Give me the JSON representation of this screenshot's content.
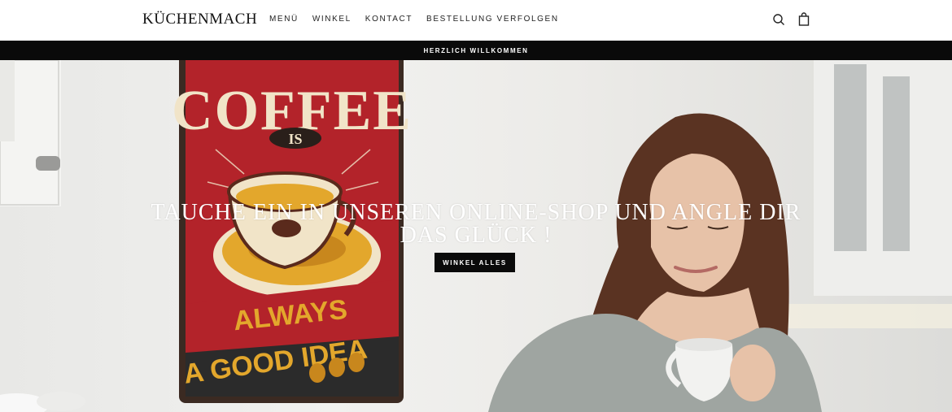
{
  "header": {
    "logo": "KÜCHENMACH",
    "nav": [
      {
        "label": "MENÜ"
      },
      {
        "label": "WINKEL"
      },
      {
        "label": "KONTACT"
      },
      {
        "label": "BESTELLUNG VERFOLGEN"
      }
    ],
    "icons": {
      "search": "search-icon",
      "cart": "shopping-bag-icon"
    }
  },
  "announcement": {
    "text": "HERZLICH WILLKOMMEN"
  },
  "hero": {
    "title": "TAUCHE EIN IN UNSEREN ONLINE-SHOP UND ANGLE DIR DAS GLÜCK !",
    "button": "WINKEL ALLES",
    "sign": {
      "line1": "COFFEE",
      "line2": "IS",
      "line3": "ALWAYS",
      "line4": "A GOOD IDEA"
    }
  },
  "colors": {
    "bar": "#0a0a0a",
    "sign_red": "#b3232a",
    "sign_cream": "#f1e4c8",
    "sign_yellow": "#e3a72c"
  }
}
